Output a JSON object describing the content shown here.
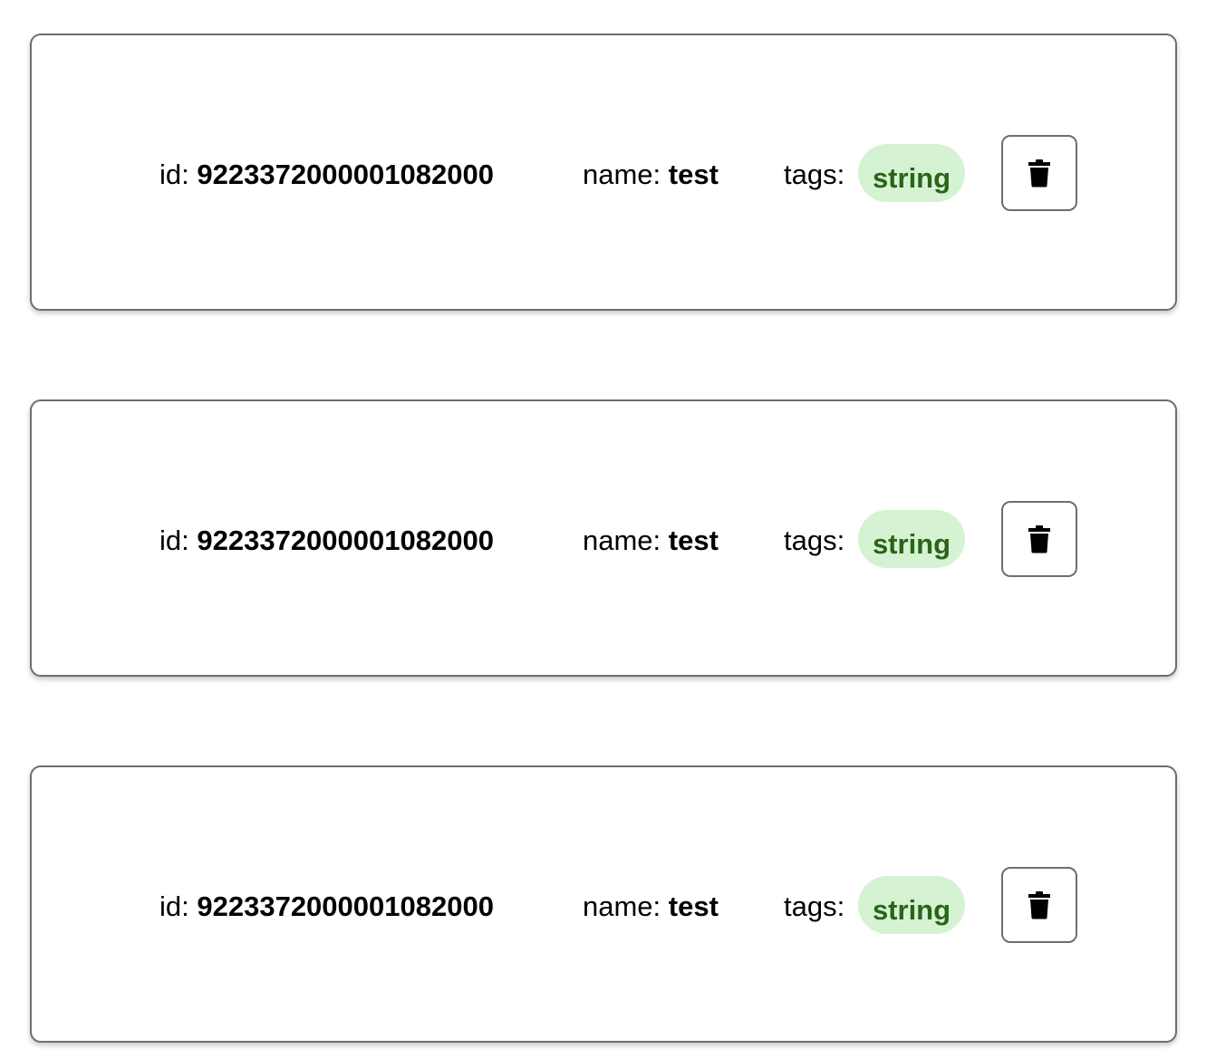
{
  "records": [
    {
      "id_label": "id:",
      "id_value": "9223372000001082000",
      "name_label": "name:",
      "name_value": "test",
      "tags_label": "tags:",
      "tags": [
        "string"
      ],
      "delete_icon": "trash-icon"
    },
    {
      "id_label": "id:",
      "id_value": "9223372000001082000",
      "name_label": "name:",
      "name_value": "test",
      "tags_label": "tags:",
      "tags": [
        "string"
      ],
      "delete_icon": "trash-icon"
    },
    {
      "id_label": "id:",
      "id_value": "9223372000001082000",
      "name_label": "name:",
      "name_value": "test",
      "tags_label": "tags:",
      "tags": [
        "string"
      ],
      "delete_icon": "trash-icon"
    }
  ],
  "colors": {
    "card_border": "#6e6e6e",
    "tag_background": "#d5f2d2",
    "tag_text": "#2a6418",
    "text": "#000000"
  }
}
